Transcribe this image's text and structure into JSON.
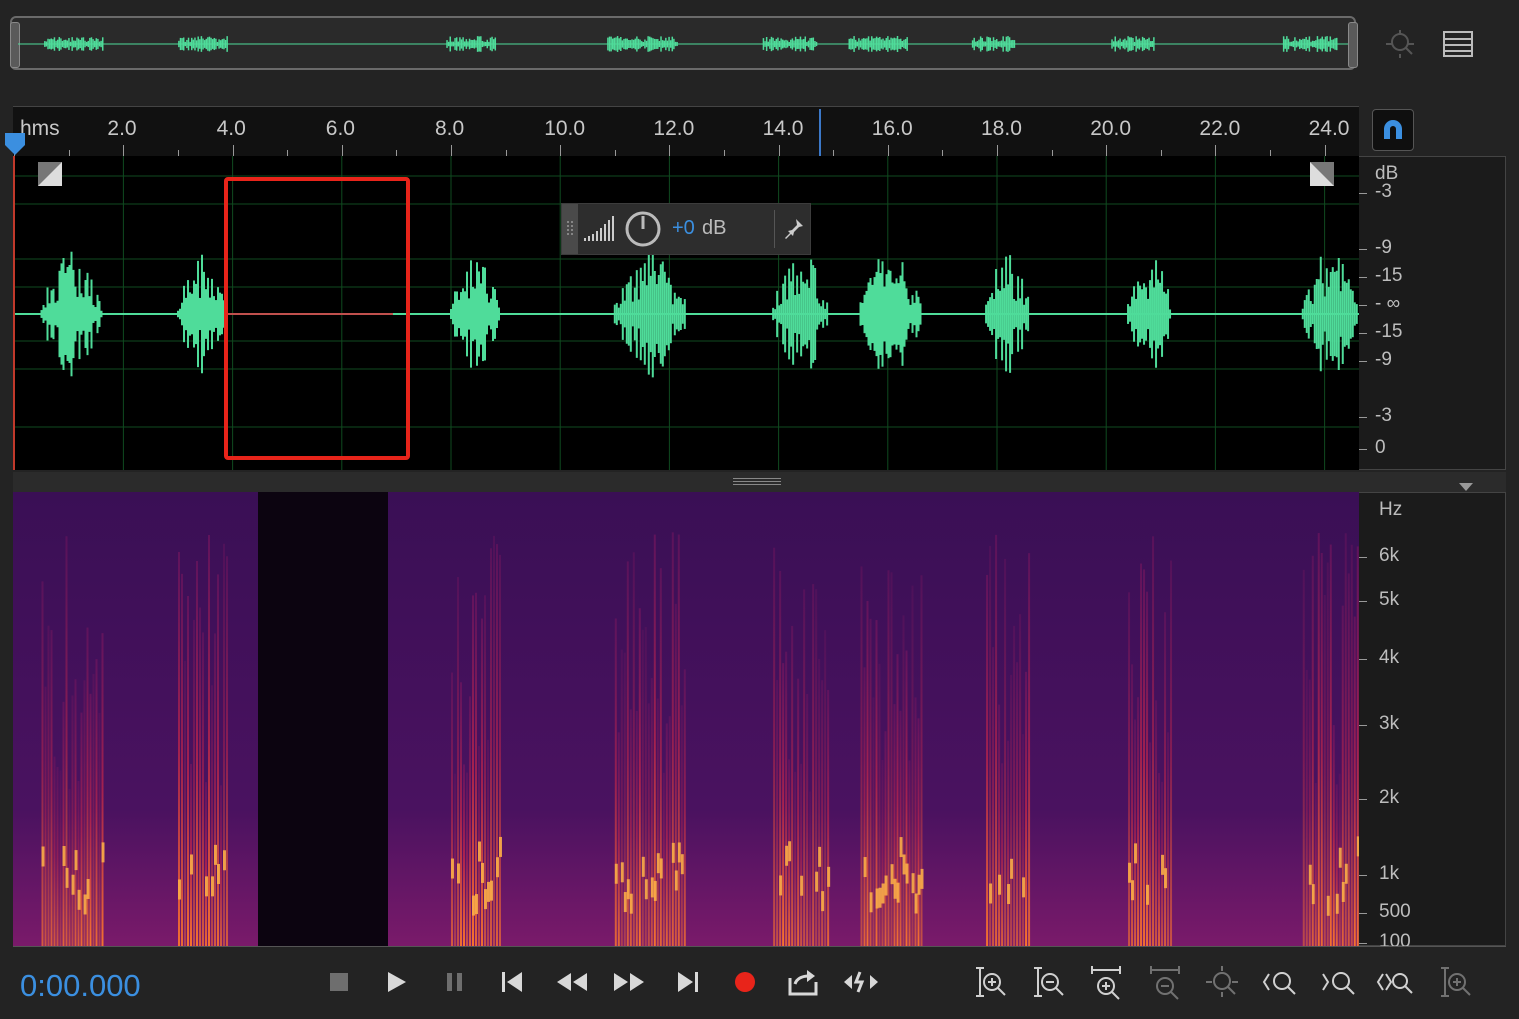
{
  "timeline": {
    "unit_label": "hms",
    "ticks": [
      "2.0",
      "4.0",
      "6.0",
      "8.0",
      "10.0",
      "12.0",
      "14.0",
      "16.0",
      "18.0",
      "20.0",
      "22.0",
      "24.0"
    ]
  },
  "waveform": {
    "db_unit": "dB",
    "db_labels": [
      "-3",
      "-9",
      "-15",
      "- ∞",
      "-15",
      "-9",
      "-3",
      "0"
    ]
  },
  "float_toolbar": {
    "gain_value": "+0",
    "gain_unit": "dB"
  },
  "spectrogram": {
    "hz_unit": "Hz",
    "hz_labels": [
      "6k",
      "5k",
      "4k",
      "3k",
      "2k",
      "1k",
      "500",
      "100"
    ]
  },
  "transport": {
    "time": "0:00.000"
  },
  "icons": {
    "stop": "stop-icon",
    "play": "play-icon",
    "pause": "pause-icon",
    "record": "record-icon"
  },
  "colors": {
    "waveform": "#4fdc9a",
    "accent": "#3b8fe0",
    "record": "#e8241a",
    "selection": "#e8241a"
  }
}
